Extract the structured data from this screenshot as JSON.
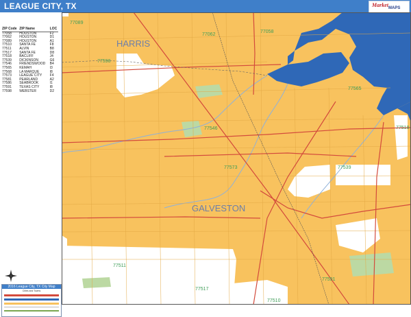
{
  "title": "LEAGUE CITY, TX",
  "logo": {
    "script_text": "Market",
    "maps_text": "MAPS"
  },
  "zip_table": {
    "headers": [
      "ZIP Code",
      "ZIP Name",
      "LOC"
    ],
    "rows": [
      [
        "77058",
        "HOUSTON",
        "F2"
      ],
      [
        "77062",
        "HOUSTON",
        "D1"
      ],
      [
        "77089",
        "HOUSTON",
        "A1"
      ],
      [
        "77510",
        "SANTA FE",
        "F8"
      ],
      [
        "77511",
        "ALVIN",
        "B8"
      ],
      [
        "77517",
        "SANTA FE",
        "D8"
      ],
      [
        "77518",
        "BACLIFF",
        "J4"
      ],
      [
        "77539",
        "DICKINSON",
        "G6"
      ],
      [
        "77546",
        "FRIENDSWOOD",
        "B4"
      ],
      [
        "77565",
        "KEMAH",
        "I3"
      ],
      [
        "77568",
        "LA MARQUE",
        "I8"
      ],
      [
        "77573",
        "LEAGUE CITY",
        "F4"
      ],
      [
        "77581",
        "PEARLAND",
        "A2"
      ],
      [
        "77586",
        "SEABROOK",
        "I1"
      ],
      [
        "77591",
        "TEXAS CITY",
        "I8"
      ],
      [
        "77598",
        "WEBSTER",
        "D2"
      ]
    ]
  },
  "legend": {
    "title": "2016 League City, TX City Map",
    "subtitle": "Cities and Towns"
  },
  "map": {
    "county_labels": [
      "HARRIS",
      "GALVESTON"
    ],
    "zip_labels": [
      {
        "code": "77089"
      },
      {
        "code": "77062"
      },
      {
        "code": "77058"
      },
      {
        "code": "77598"
      },
      {
        "code": "77565"
      },
      {
        "code": "77546"
      },
      {
        "code": "77573"
      },
      {
        "code": "77539"
      },
      {
        "code": "77518"
      },
      {
        "code": "77511"
      },
      {
        "code": "77517"
      },
      {
        "code": "77510"
      },
      {
        "code": "77591"
      }
    ]
  },
  "colors": {
    "land": "#f8c25e",
    "water": "#2f68b7",
    "roads": "#d34a3c",
    "white_area": "#ffffff",
    "title_bar": "#3f7fc9"
  }
}
